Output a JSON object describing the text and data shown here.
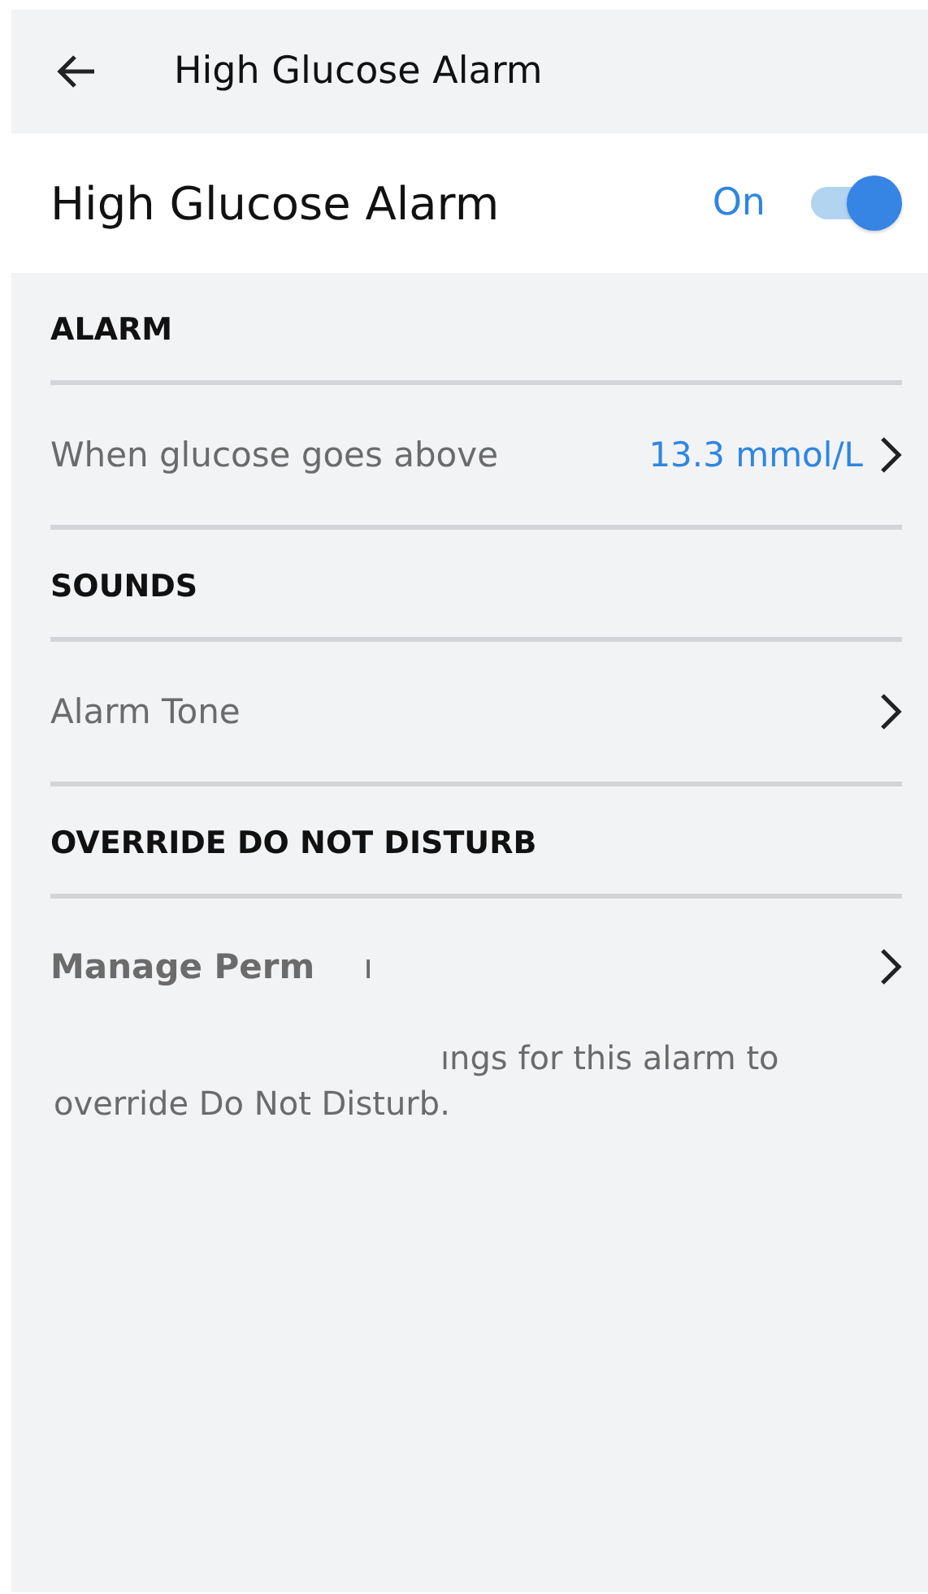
{
  "top_bar": {
    "title": "High Glucose Alarm"
  },
  "alarm_toggle": {
    "label": "High Glucose Alarm",
    "state_text": "On",
    "on": true
  },
  "sections": [
    {
      "heading": "ALARM",
      "rows": [
        {
          "kind": "value",
          "label": "When glucose goes above",
          "value": "13.3 mmol/L"
        }
      ]
    },
    {
      "heading": "SOUNDS",
      "rows": [
        {
          "kind": "plain",
          "label": "Alarm Tone"
        }
      ]
    },
    {
      "heading": "OVERRIDE DO NOT DISTURB",
      "rows": [
        {
          "kind": "permission",
          "label": "Manage Perm",
          "fragment": "ı",
          "description_lines": [
            "ıngs for this alarm to",
            "override Do Not Disturb."
          ]
        }
      ]
    }
  ]
}
